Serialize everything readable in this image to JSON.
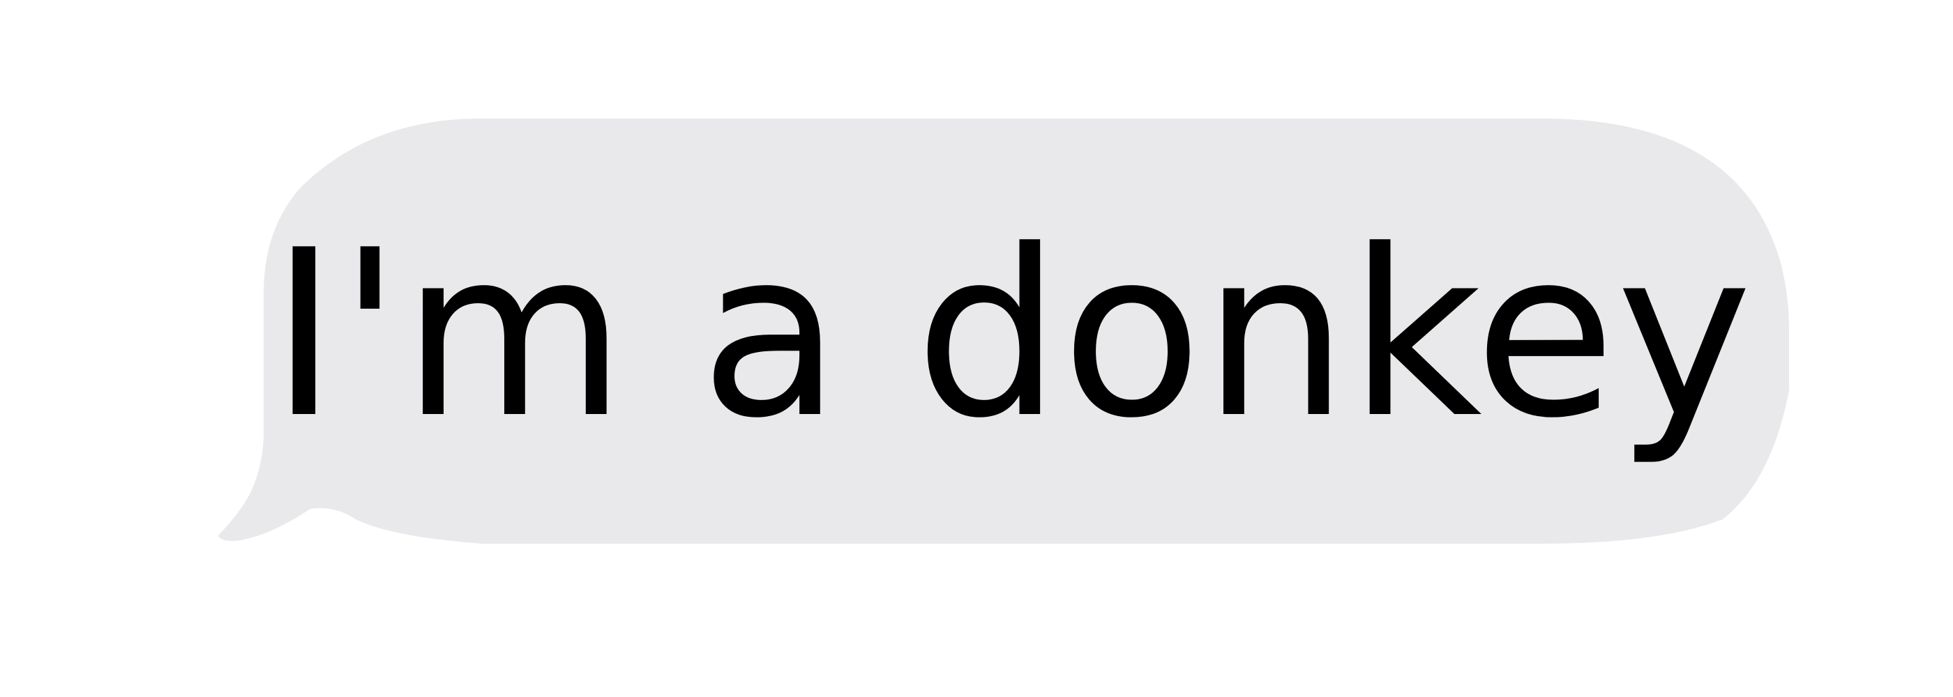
{
  "message": {
    "text": "I'm a donkey",
    "sender": "incoming",
    "bubble_color": "#e9e9eb",
    "text_color": "#000000"
  }
}
